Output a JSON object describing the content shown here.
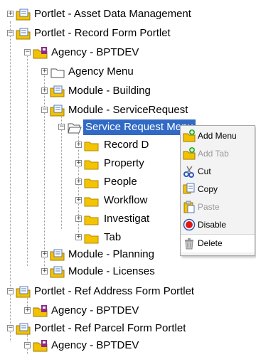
{
  "tree": {
    "nodes": [
      {
        "label": "Portlet - Asset Data Management"
      },
      {
        "label": "Portlet - Record Form Portlet"
      },
      {
        "label": "Agency - BPTDEV"
      },
      {
        "label": "Agency Menu"
      },
      {
        "label": "Module - Building"
      },
      {
        "label": "Module - ServiceRequest"
      },
      {
        "label": "Service Request Menu"
      },
      {
        "label": "Record D"
      },
      {
        "label": "Property"
      },
      {
        "label": "People"
      },
      {
        "label": "Workflow"
      },
      {
        "label": "Investigat"
      },
      {
        "label": "Tab"
      },
      {
        "label": "Module - Planning"
      },
      {
        "label": "Module - Licenses"
      },
      {
        "label": "Portlet - Ref Address Form Portlet"
      },
      {
        "label": "Agency - BPTDEV"
      },
      {
        "label": "Portlet - Ref Parcel Form Portlet"
      },
      {
        "label": "Agency - BPTDEV"
      }
    ],
    "toggle_collapsed": "+",
    "toggle_expanded": "−"
  },
  "context_menu": {
    "items": [
      {
        "label": "Add Menu",
        "icon": "add-menu-icon",
        "enabled": true
      },
      {
        "label": "Add Tab",
        "icon": "add-tab-icon",
        "enabled": false
      },
      {
        "label": "Cut",
        "icon": "scissors-icon",
        "enabled": true
      },
      {
        "label": "Copy",
        "icon": "copy-icon",
        "enabled": true
      },
      {
        "label": "Paste",
        "icon": "paste-icon",
        "enabled": false
      },
      {
        "label": "Disable",
        "icon": "disable-icon",
        "enabled": true
      },
      {
        "label": "Delete",
        "icon": "trash-icon",
        "enabled": true
      }
    ]
  },
  "colors": {
    "selection": "#316ac5",
    "folder": "#f5c400",
    "portlet_folder": "#e6b800"
  }
}
